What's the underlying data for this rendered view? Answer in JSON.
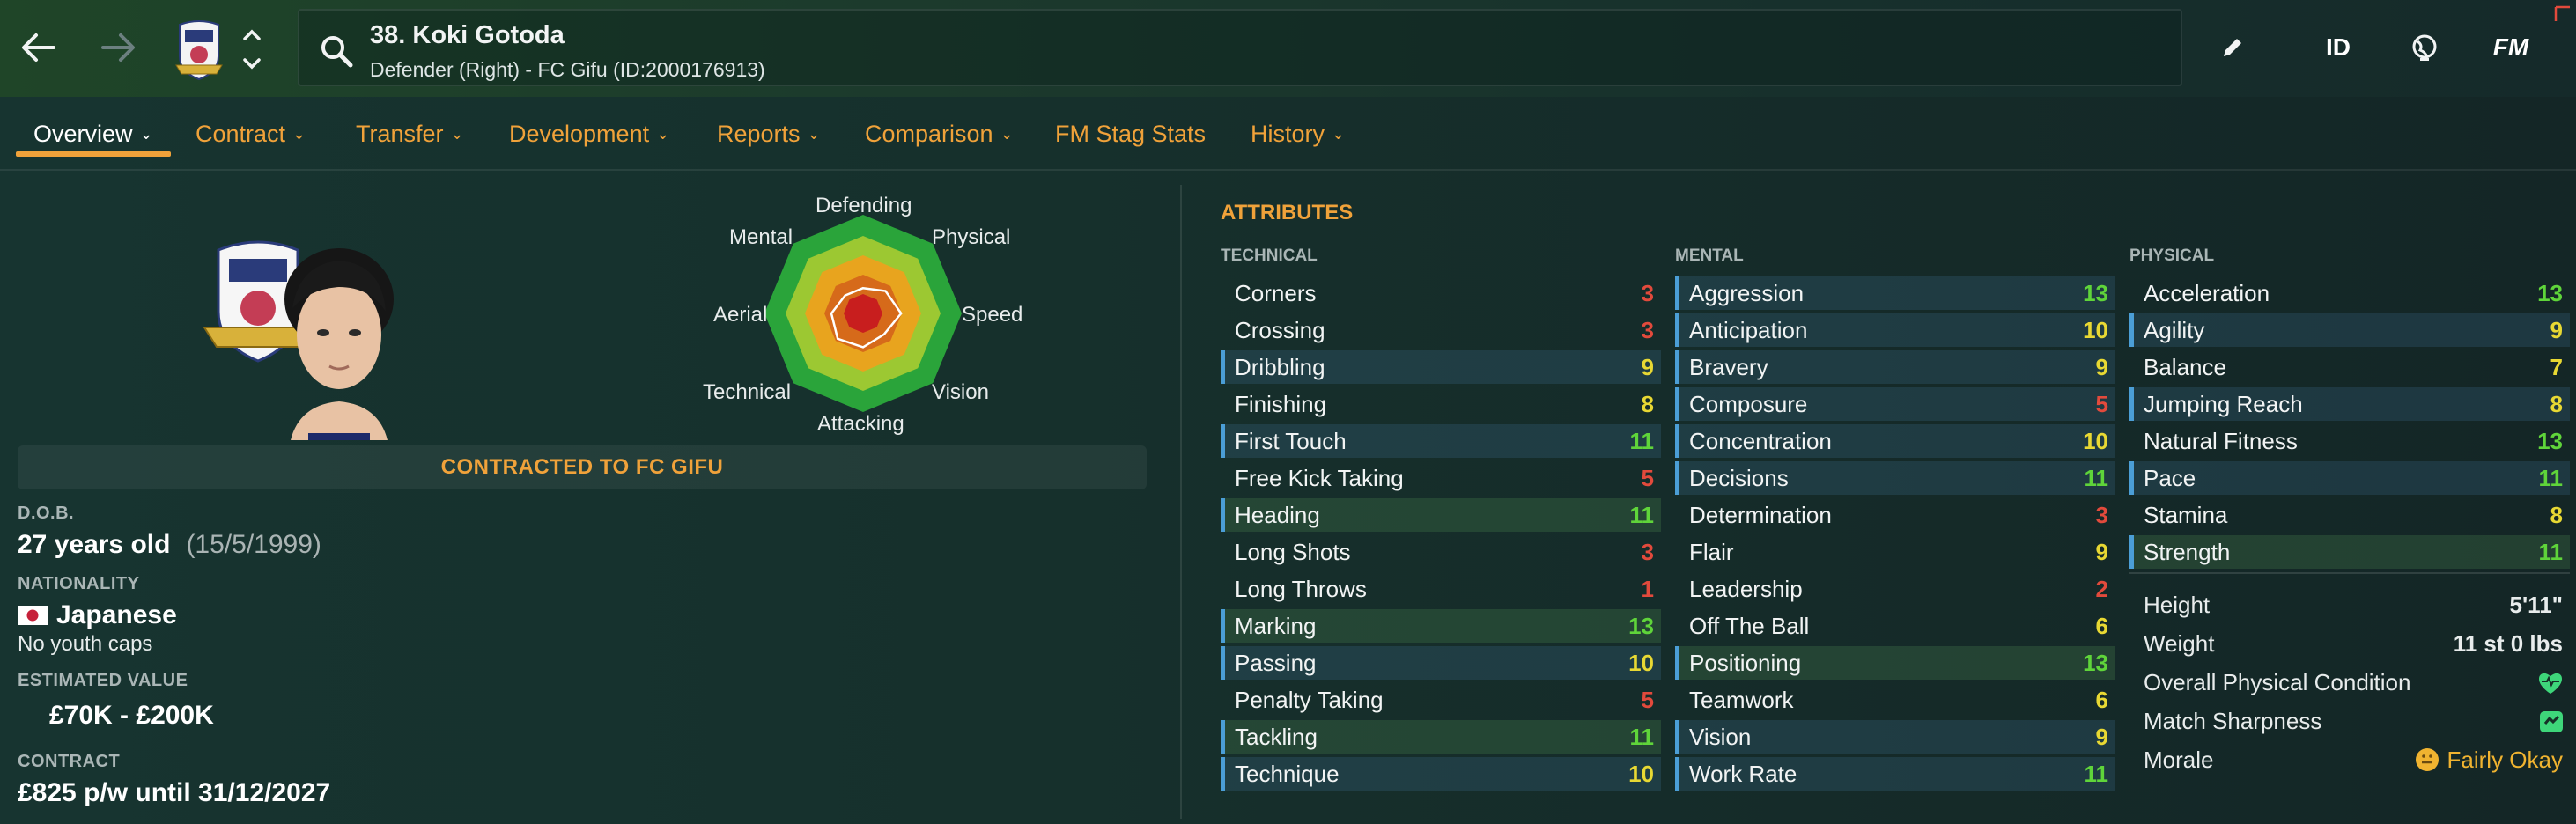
{
  "header": {
    "player_name": "38. Koki Gotoda",
    "player_subtitle": "Defender (Right) - FC Gifu (ID:2000176913)",
    "id_label": "ID",
    "fm_label": "FM"
  },
  "tabs": [
    {
      "label": "Overview"
    },
    {
      "label": "Contract"
    },
    {
      "label": "Transfer"
    },
    {
      "label": "Development"
    },
    {
      "label": "Reports"
    },
    {
      "label": "Comparison"
    },
    {
      "label": "FM Stag Stats"
    },
    {
      "label": "History"
    }
  ],
  "radar": {
    "labels": [
      "Defending",
      "Physical",
      "Speed",
      "Vision",
      "Attacking",
      "Technical",
      "Aerial",
      "Mental"
    ]
  },
  "overview": {
    "contract_banner": "CONTRACTED TO FC GIFU",
    "dob_label": "D.O.B.",
    "age": "27 years old",
    "dob": "(15/5/1999)",
    "nationality_label": "NATIONALITY",
    "nationality": "Japanese",
    "caps": "No youth caps",
    "value_label": "ESTIMATED VALUE",
    "value": "£70K - £200K",
    "contract_label": "CONTRACT",
    "contract": "£825 p/w until 31/12/2027"
  },
  "attributes": {
    "title": "ATTRIBUTES",
    "technical_label": "TECHNICAL",
    "mental_label": "MENTAL",
    "physical_label": "PHYSICAL",
    "technical": [
      {
        "name": "Corners",
        "value": "3"
      },
      {
        "name": "Crossing",
        "value": "3"
      },
      {
        "name": "Dribbling",
        "value": "9"
      },
      {
        "name": "Finishing",
        "value": "8"
      },
      {
        "name": "First Touch",
        "value": "11"
      },
      {
        "name": "Free Kick Taking",
        "value": "5"
      },
      {
        "name": "Heading",
        "value": "11"
      },
      {
        "name": "Long Shots",
        "value": "3"
      },
      {
        "name": "Long Throws",
        "value": "1"
      },
      {
        "name": "Marking",
        "value": "13"
      },
      {
        "name": "Passing",
        "value": "10"
      },
      {
        "name": "Penalty Taking",
        "value": "5"
      },
      {
        "name": "Tackling",
        "value": "11"
      },
      {
        "name": "Technique",
        "value": "10"
      }
    ],
    "mental": [
      {
        "name": "Aggression",
        "value": "13"
      },
      {
        "name": "Anticipation",
        "value": "10"
      },
      {
        "name": "Bravery",
        "value": "9"
      },
      {
        "name": "Composure",
        "value": "5"
      },
      {
        "name": "Concentration",
        "value": "10"
      },
      {
        "name": "Decisions",
        "value": "11"
      },
      {
        "name": "Determination",
        "value": "3"
      },
      {
        "name": "Flair",
        "value": "9"
      },
      {
        "name": "Leadership",
        "value": "2"
      },
      {
        "name": "Off The Ball",
        "value": "6"
      },
      {
        "name": "Positioning",
        "value": "13"
      },
      {
        "name": "Teamwork",
        "value": "6"
      },
      {
        "name": "Vision",
        "value": "9"
      },
      {
        "name": "Work Rate",
        "value": "11"
      }
    ],
    "physical": [
      {
        "name": "Acceleration",
        "value": "13"
      },
      {
        "name": "Agility",
        "value": "9"
      },
      {
        "name": "Balance",
        "value": "7"
      },
      {
        "name": "Jumping Reach",
        "value": "8"
      },
      {
        "name": "Natural Fitness",
        "value": "13"
      },
      {
        "name": "Pace",
        "value": "11"
      },
      {
        "name": "Stamina",
        "value": "8"
      },
      {
        "name": "Strength",
        "value": "11"
      }
    ]
  },
  "physical_info": {
    "height_label": "Height",
    "height": "5'11\"",
    "weight_label": "Weight",
    "weight": "11 st 0 lbs",
    "condition_label": "Overall Physical Condition",
    "sharpness_label": "Match Sharpness",
    "morale_label": "Morale",
    "morale": "Fairly Okay"
  },
  "colors": {
    "accent": "#f0a23a",
    "low": "#e24a3c",
    "mid": "#e8d833",
    "high": "#5fd43a"
  }
}
